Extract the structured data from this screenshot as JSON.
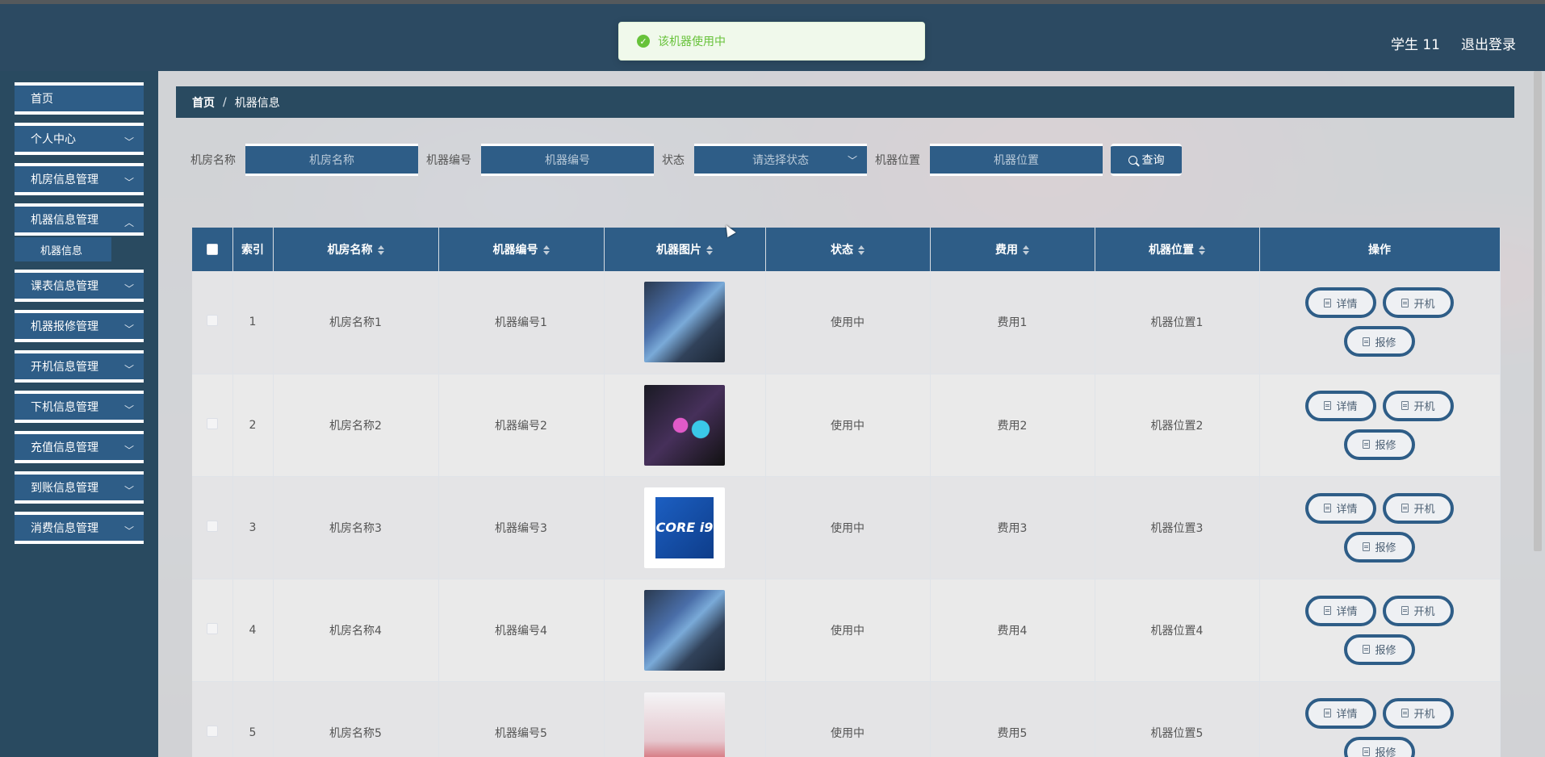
{
  "topbar": {
    "user": "学生 11",
    "logout": "退出登录"
  },
  "toast": {
    "message": "该机器使用中"
  },
  "sidebar": {
    "items": [
      {
        "label": "首页"
      },
      {
        "label": "个人中心"
      },
      {
        "label": "机房信息管理"
      },
      {
        "label": "机器信息管理"
      },
      {
        "label": "课表信息管理"
      },
      {
        "label": "机器报修管理"
      },
      {
        "label": "开机信息管理"
      },
      {
        "label": "下机信息管理"
      },
      {
        "label": "充值信息管理"
      },
      {
        "label": "到账信息管理"
      },
      {
        "label": "消费信息管理"
      }
    ],
    "sub_item": "机器信息"
  },
  "breadcrumb": {
    "home": "首页",
    "separator": "/",
    "current": "机器信息"
  },
  "filters": {
    "room_label": "机房名称",
    "room_placeholder": "机房名称",
    "code_label": "机器编号",
    "code_placeholder": "机器编号",
    "status_label": "状态",
    "status_placeholder": "请选择状态",
    "location_label": "机器位置",
    "location_placeholder": "机器位置",
    "search_label": "查询"
  },
  "table": {
    "headers": {
      "index": "索引",
      "room": "机房名称",
      "code": "机器编号",
      "image": "机器图片",
      "status": "状态",
      "fee": "费用",
      "location": "机器位置",
      "ops": "操作"
    },
    "rows": [
      {
        "index": "1",
        "room": "机房名称1",
        "code": "机器编号1",
        "status": "使用中",
        "fee": "费用1",
        "location": "机器位置1"
      },
      {
        "index": "2",
        "room": "机房名称2",
        "code": "机器编号2",
        "status": "使用中",
        "fee": "费用2",
        "location": "机器位置2"
      },
      {
        "index": "3",
        "room": "机房名称3",
        "code": "机器编号3",
        "status": "使用中",
        "fee": "费用3",
        "location": "机器位置3"
      },
      {
        "index": "4",
        "room": "机房名称4",
        "code": "机器编号4",
        "status": "使用中",
        "fee": "费用4",
        "location": "机器位置4"
      },
      {
        "index": "5",
        "room": "机房名称5",
        "code": "机器编号5",
        "status": "使用中",
        "fee": "费用5",
        "location": "机器位置5"
      }
    ],
    "buttons": {
      "detail": "详情",
      "boot": "开机",
      "repair": "报修"
    },
    "cpu_text": "CORE i9"
  },
  "colors": {
    "primary": "#2e5d87",
    "topbar": "#2c4a62",
    "success": "#67c23a"
  }
}
